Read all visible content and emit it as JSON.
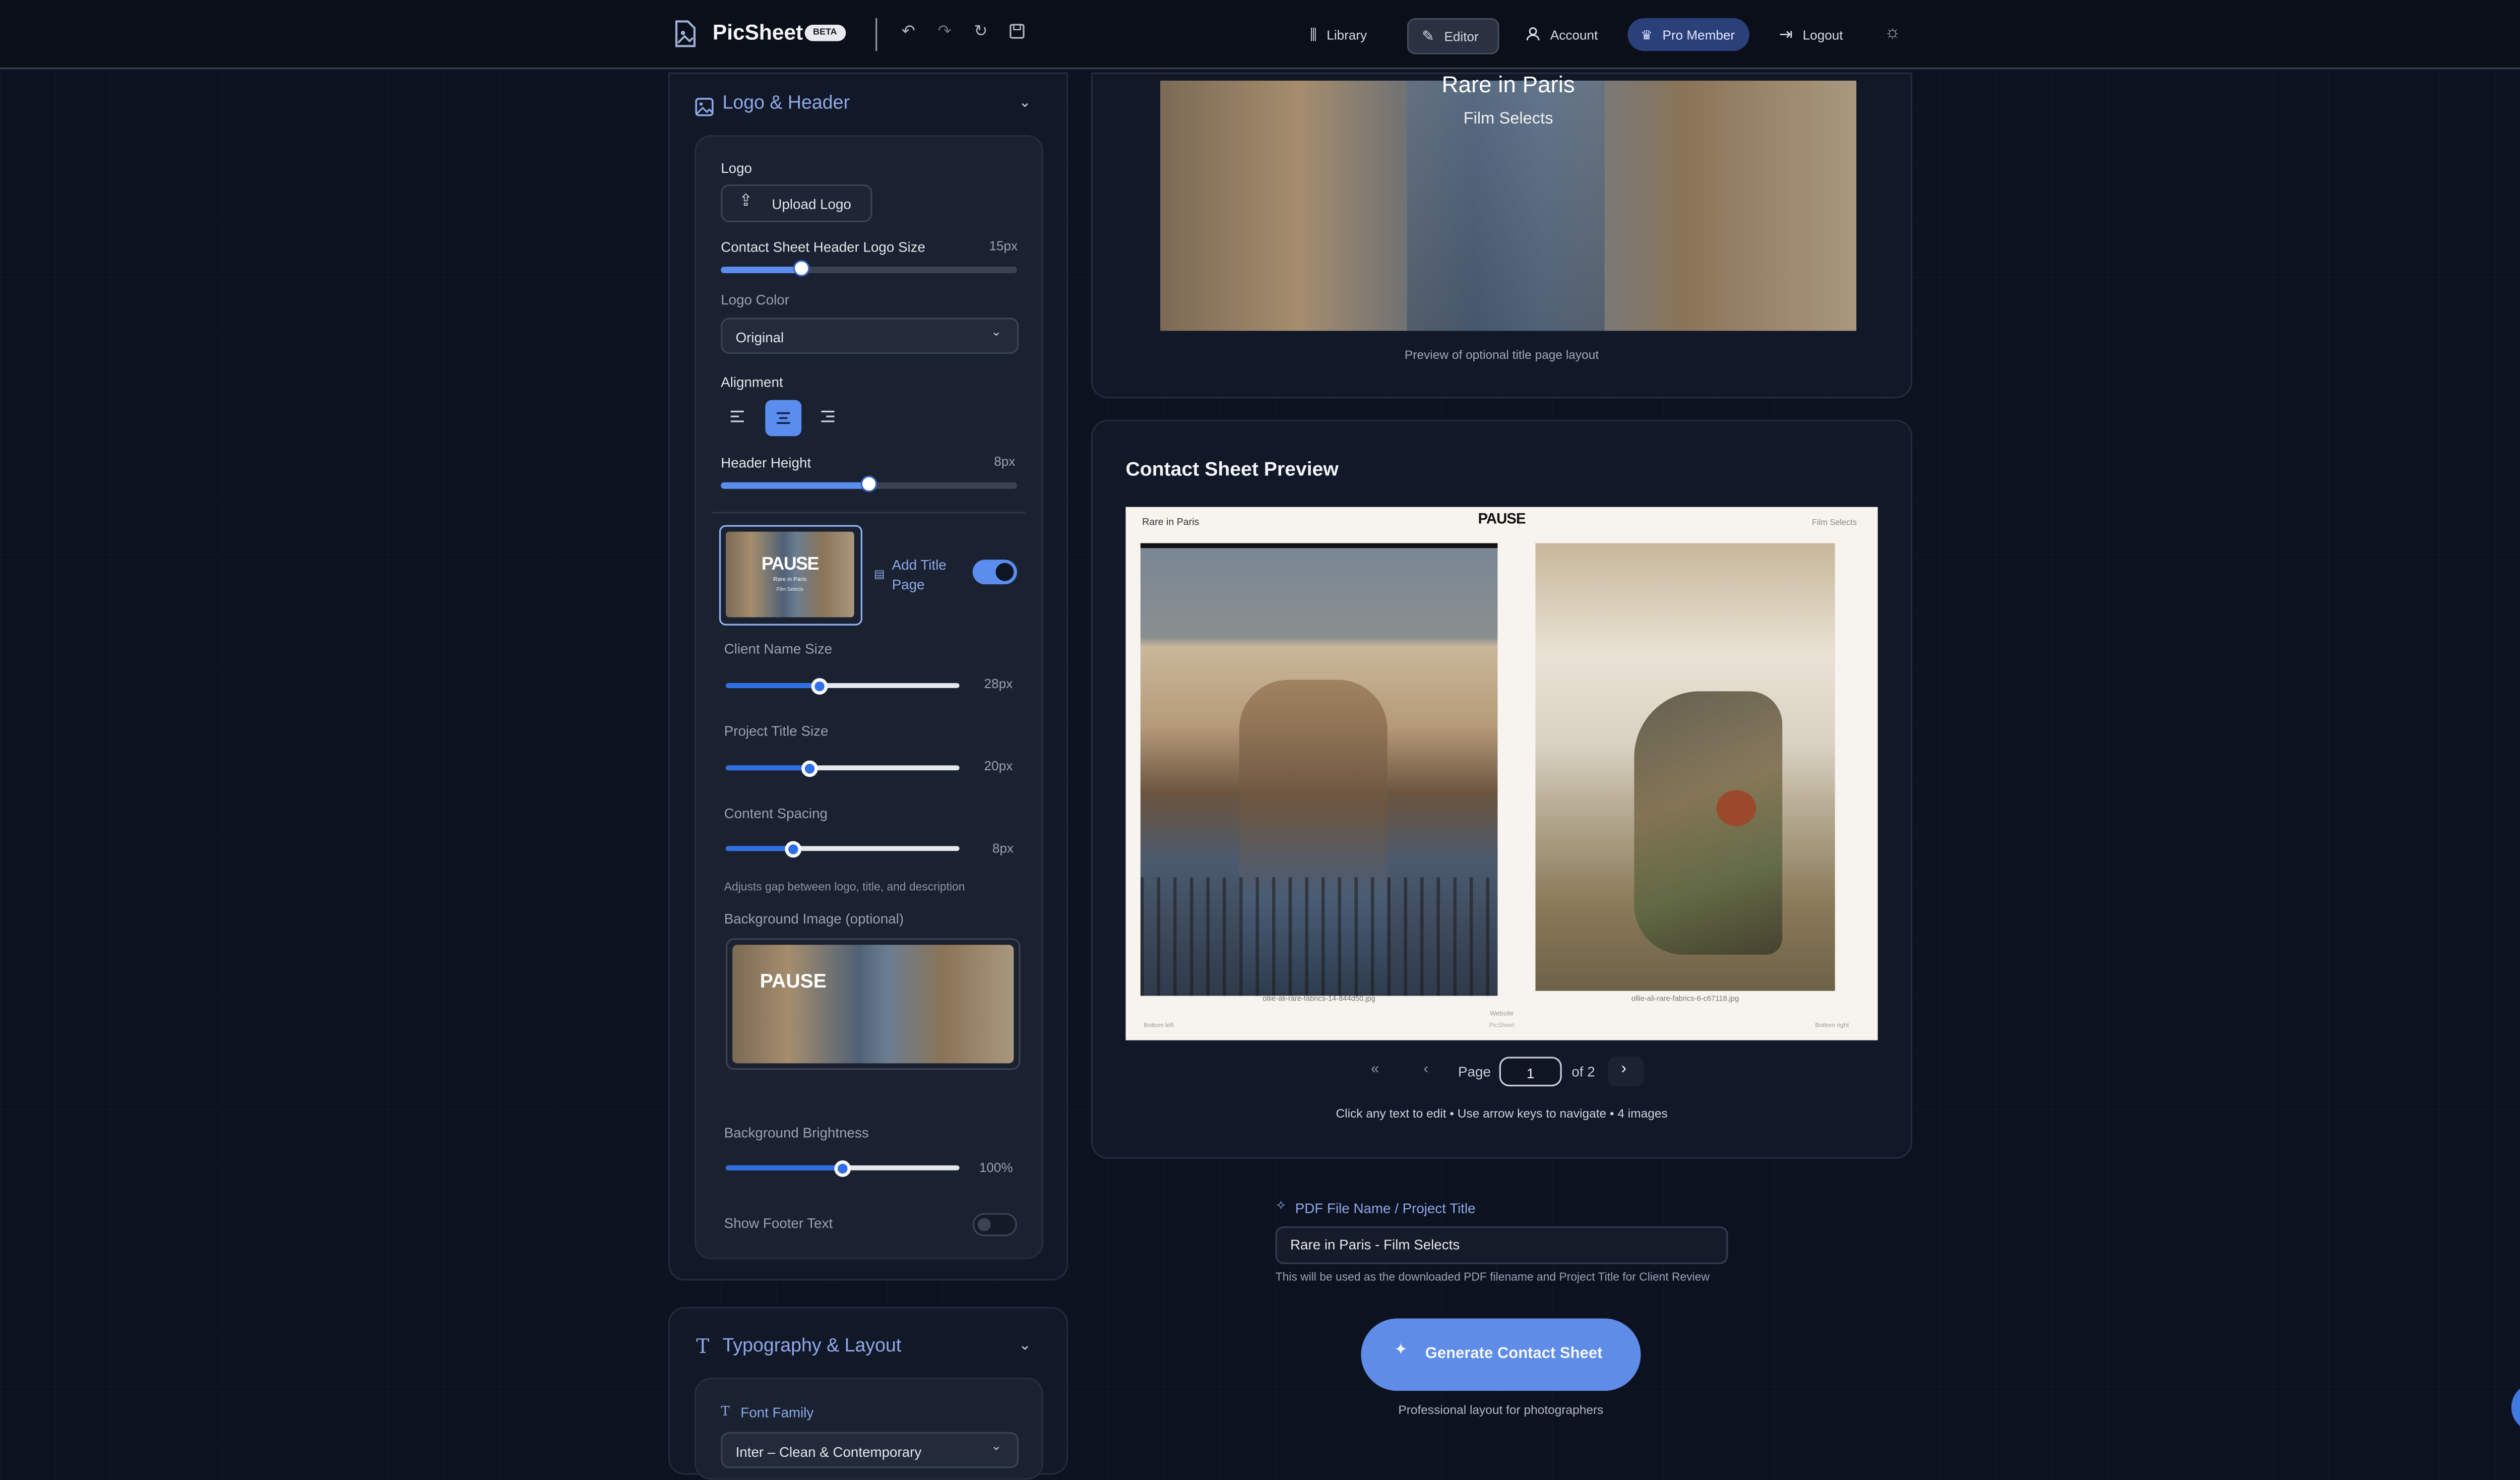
{
  "app": {
    "name": "PicSheet",
    "badge": "BETA"
  },
  "nav": {
    "library": "Library",
    "editor": "Editor",
    "account": "Account",
    "pro": "Pro Member",
    "logout": "Logout"
  },
  "logo_header": {
    "title": "Logo & Header",
    "logo_label": "Logo",
    "upload_label": "Upload Logo",
    "logo_size_label": "Contact Sheet Header Logo Size",
    "logo_size_value": "15px",
    "logo_size_level": 0.27,
    "logo_color_label": "Logo Color",
    "logo_color_value": "Original",
    "alignment_label": "Alignment",
    "alignment_selected": "center",
    "header_height_label": "Header Height",
    "header_height_value": "8px",
    "header_height_level": 0.5,
    "add_title_page_label": "Add Title Page",
    "add_title_page_on": true,
    "thumb_title": "PAUSE",
    "thumb_sub1": "Rare in Paris",
    "thumb_sub2": "Film Selects",
    "client_name_label": "Client Name Size",
    "client_name_value": "28px",
    "client_name_level": 0.4,
    "project_title_label": "Project Title Size",
    "project_title_value": "20px",
    "project_title_level": 0.36,
    "content_spacing_label": "Content Spacing",
    "content_spacing_value": "8px",
    "content_spacing_level": 0.29,
    "content_spacing_hint": "Adjusts gap between logo, title, and description",
    "bg_image_label": "Background Image (optional)",
    "bg_brightness_label": "Background Brightness",
    "bg_brightness_value": "100%",
    "bg_brightness_level": 0.5,
    "footer_label": "Show Footer Text",
    "footer_on": false
  },
  "typography": {
    "title": "Typography & Layout",
    "font_family_label": "Font Family",
    "font_family_value": "Inter – Clean & Contemporary"
  },
  "title_preview": {
    "title": "Rare in Paris",
    "subtitle": "Film Selects",
    "caption": "Preview of optional title page layout"
  },
  "contact_preview": {
    "heading": "Contact Sheet Preview",
    "sheet_left": "Rare in Paris",
    "sheet_logo": "PAUSE",
    "sheet_right": "Film Selects",
    "file1": "ollie-ali-rare-fabrics-14-844d50.jpg",
    "file2": "ollie-ali-rare-fabrics-6-c67118.jpg",
    "footer_left": "Bottom left",
    "footer_center1": "Website",
    "footer_center2": "PicSheet",
    "footer_right": "Bottom right",
    "page_label": "Page",
    "page_value": "1",
    "page_of": "of 2",
    "hint": "Click any text to edit • Use arrow keys to navigate • 4 images"
  },
  "pdf": {
    "label": "PDF File Name / Project Title",
    "value": "Rare in Paris - Film Selects",
    "hint": "This will be used as the downloaded PDF filename and Project Title for Client Review",
    "generate": "Generate Contact Sheet",
    "generate_sub": "Professional layout for photographers"
  },
  "colors": {
    "accent": "#5b8def",
    "background": "#0c1220",
    "panel": "#111827",
    "button": "#5f8ce6"
  }
}
